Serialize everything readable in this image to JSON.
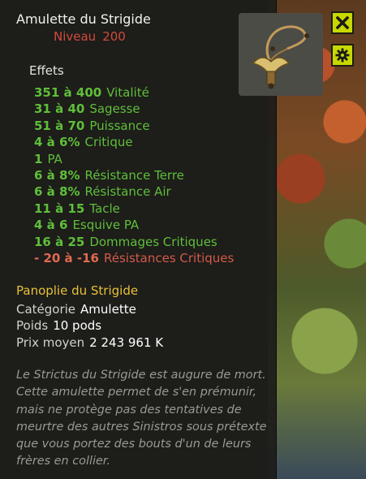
{
  "item": {
    "name": "Amulette du Strigide",
    "level_label": "Niveau",
    "level_value": "200"
  },
  "effects_header": "Effets",
  "effects": [
    {
      "value": "351 à 400",
      "stat": "Vitalité",
      "negative": false
    },
    {
      "value": "31 à 40",
      "stat": "Sagesse",
      "negative": false
    },
    {
      "value": "51 à 70",
      "stat": "Puissance",
      "negative": false
    },
    {
      "value": "4 à 6%",
      "stat": "Critique",
      "negative": false
    },
    {
      "value": "1",
      "stat": "PA",
      "negative": false
    },
    {
      "value": "6 à 8%",
      "stat": "Résistance Terre",
      "negative": false
    },
    {
      "value": "6 à 8%",
      "stat": "Résistance Air",
      "negative": false
    },
    {
      "value": "11 à 15",
      "stat": "Tacle",
      "negative": false
    },
    {
      "value": "4 à 6",
      "stat": "Esquive PA",
      "negative": false
    },
    {
      "value": "16 à 25",
      "stat": "Dommages Critiques",
      "negative": false
    },
    {
      "value": "- 20 à -16",
      "stat": "Résistances Critiques",
      "negative": true
    }
  ],
  "set_name": "Panoplie du Strigide",
  "details": {
    "category_label": "Catégorie",
    "category_value": "Amulette",
    "weight_label": "Poids",
    "weight_value": "10 pods",
    "price_label": "Prix moyen",
    "price_value": "2 243 961 K"
  },
  "description_lines": [
    "Le Strictus du Strigide est augure de mort.",
    "Cette amulette permet de s'en prémunir,",
    "mais ne protège pas des tentatives de",
    "meurtre des autres Sinistros sous prétexte",
    "que vous portez des bouts d'un de leurs",
    "frères en collier."
  ],
  "icons": {
    "close": "close-icon",
    "settings": "gear-icon",
    "item": "amulet-icon"
  },
  "colors": {
    "positive": "#5fbf3a",
    "negative": "#d25a4a",
    "set": "#e9c13a",
    "level": "#d24a3c",
    "button": "#c8d800"
  }
}
